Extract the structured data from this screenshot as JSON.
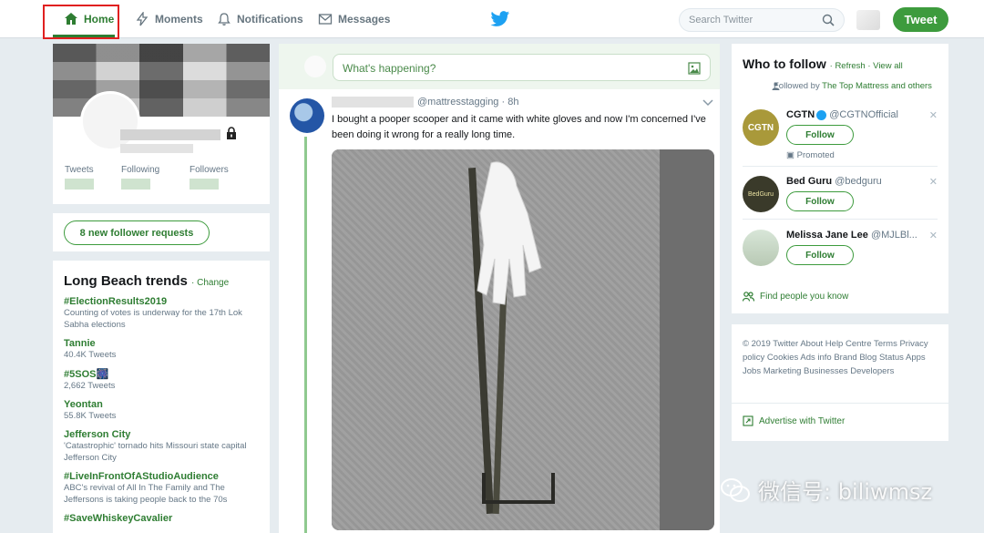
{
  "nav": {
    "home": "Home",
    "moments": "Moments",
    "notifications": "Notifications",
    "messages": "Messages",
    "search_placeholder": "Search Twitter",
    "tweet_button": "Tweet"
  },
  "profile": {
    "stats": [
      {
        "label": "Tweets"
      },
      {
        "label": "Following"
      },
      {
        "label": "Followers"
      }
    ]
  },
  "follower_requests": "8 new follower requests",
  "trends": {
    "title": "Long Beach trends",
    "change": "Change",
    "items": [
      {
        "name": "#ElectionResults2019",
        "meta": "Counting of votes is underway for the 17th Lok Sabha elections"
      },
      {
        "name": "Tannie",
        "meta": "40.4K Tweets"
      },
      {
        "name": "#5SOS🎆",
        "meta": "2,662 Tweets"
      },
      {
        "name": "Yeontan",
        "meta": "55.8K Tweets"
      },
      {
        "name": "Jefferson City",
        "meta": "'Catastrophic' tornado hits Missouri state capital Jefferson City"
      },
      {
        "name": "#LiveInFrontOfAStudioAudience",
        "meta": "ABC's revival of All In The Family and The Jeffersons is taking people back to the 70s"
      },
      {
        "name": "#SaveWhiskeyCavalier",
        "meta": ""
      }
    ]
  },
  "compose": {
    "placeholder": "What's happening?"
  },
  "tweet": {
    "handle_time": "@mattresstagging · 8h",
    "text": "I bought a pooper scooper and it came with white gloves and now I'm concerned I've been doing it wrong for a really long time."
  },
  "who_to_follow": {
    "title": "Who to follow",
    "links": "· Refresh · View all",
    "followed_by_prefix": "Followed by ",
    "followed_by_name": "The Top Mattress and others",
    "suggestions": [
      {
        "name": "CGTN",
        "handle": "@CGTNOfficial",
        "follow": "Follow",
        "promoted": "Promoted",
        "avatar_text": "CGTN"
      },
      {
        "name": "Bed Guru",
        "handle": "@bedguru",
        "follow": "Follow",
        "avatar_text": "BedGuru"
      },
      {
        "name": "Melissa Jane Lee",
        "handle": "@MJLBl...",
        "follow": "Follow"
      }
    ],
    "find_people": "Find people you know"
  },
  "footer": {
    "links": "© 2019 Twitter  About  Help Centre  Terms  Privacy policy  Cookies  Ads info  Brand  Blog  Status  Apps  Jobs  Marketing  Businesses  Developers",
    "advertise": "Advertise with Twitter"
  },
  "watermark": "微信号: biliwmsz",
  "colors": {
    "accent": "#2e7d32",
    "tweet_button": "#3d9b3d",
    "highlight": "#e02020"
  }
}
